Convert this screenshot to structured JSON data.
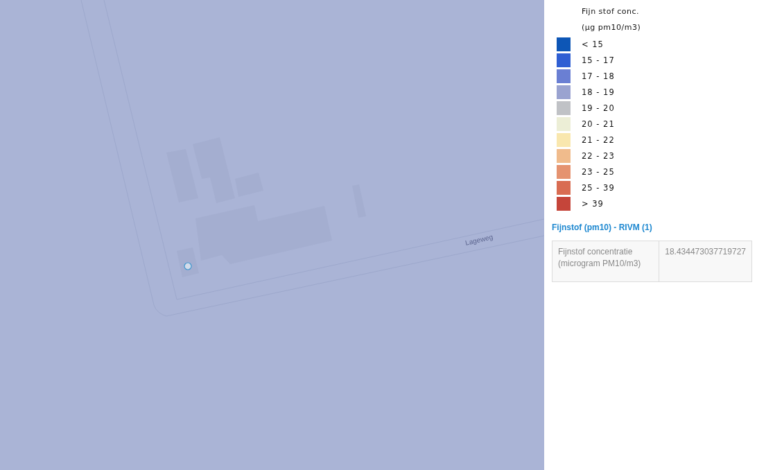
{
  "map": {
    "street_label": "Lageweg"
  },
  "legend": {
    "title_lines": [
      "Fijn stof conc.",
      "(µg pm10/m3)"
    ],
    "classes": [
      {
        "label": "< 15",
        "color": "#0d56b6"
      },
      {
        "label": "15 - 17",
        "color": "#2f5fd3"
      },
      {
        "label": "17 - 18",
        "color": "#6a7fd3"
      },
      {
        "label": "18 - 19",
        "color": "#9aa3d0"
      },
      {
        "label": "19 - 20",
        "color": "#c0c2c6"
      },
      {
        "label": "20 - 21",
        "color": "#eceed6"
      },
      {
        "label": "21 - 22",
        "color": "#f9e7ae"
      },
      {
        "label": "22 - 23",
        "color": "#f0bb8c"
      },
      {
        "label": "23 - 25",
        "color": "#e59370"
      },
      {
        "label": "25 - 39",
        "color": "#d96c52"
      },
      {
        "label": "> 39",
        "color": "#c5453a"
      }
    ]
  },
  "feature_info": {
    "title": "Fijnstof (pm10) - RIVM (1)",
    "rows": [
      {
        "label": "Fijnstof concentratie (microgram PM10/m3)",
        "value": "18.434473037719727"
      }
    ]
  }
}
